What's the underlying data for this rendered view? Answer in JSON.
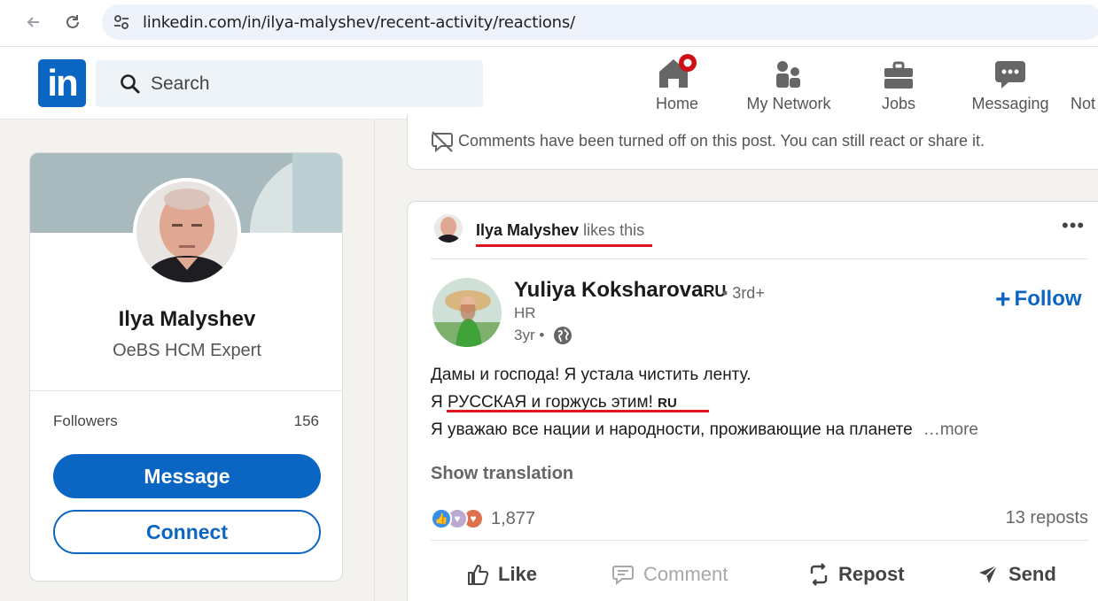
{
  "browser": {
    "url": "linkedin.com/in/ilya-malyshev/recent-activity/reactions/"
  },
  "header": {
    "logo": "in",
    "search_placeholder": "Search",
    "nav": [
      {
        "label": "Home",
        "icon": "home-icon",
        "has_notification_dot": true
      },
      {
        "label": "My Network",
        "icon": "people-icon"
      },
      {
        "label": "Jobs",
        "icon": "briefcase-icon"
      },
      {
        "label": "Messaging",
        "icon": "chat-icon"
      },
      {
        "label": "Not",
        "icon": "bell-icon"
      }
    ]
  },
  "profile": {
    "name": "Ilya Malyshev",
    "headline": "OeBS HCM Expert",
    "followers_label": "Followers",
    "followers_count": "156",
    "message_label": "Message",
    "connect_label": "Connect"
  },
  "prev_post": {
    "comments_off_text": "Comments have been turned off on this post. You can still react or share it."
  },
  "post": {
    "liker_name": "Ilya Malyshev",
    "liker_action": " likes this",
    "author_name": "Yuliya Koksharova",
    "author_flag": "RU",
    "author_degree": "• 3rd+",
    "author_title": "HR",
    "author_time": "3yr •",
    "follow_label": "Follow",
    "text_line1": "Дамы и господа! Я устала чистить ленту.",
    "text_line2": "Я РУССКАЯ и горжусь этим! ",
    "text_line2_flag": "RU",
    "text_line3": "Я уважаю все нации и народности, проживающие на планете",
    "see_more": "…more",
    "show_translation": "Show translation",
    "reaction_count": "1,877",
    "reposts": "13 reposts",
    "actions": {
      "like": "Like",
      "comment": "Comment",
      "repost": "Repost",
      "send": "Send"
    }
  },
  "colors": {
    "linkedin_blue": "#0a66c2",
    "annotation_red": "#e0141e",
    "page_bg": "#f4f2ee"
  }
}
